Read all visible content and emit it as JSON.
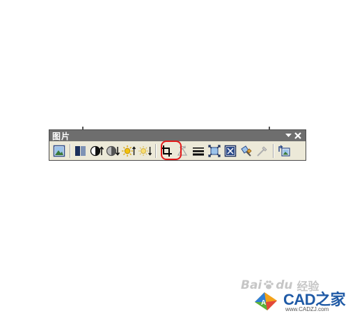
{
  "toolbar": {
    "title": "图片",
    "dropdown_icon": "triangle-down-icon",
    "close_icon": "close-icon",
    "buttons": [
      {
        "name": "insert-picture-button",
        "icon": "insert-picture-icon"
      },
      {
        "name": "image-control-button",
        "icon": "image-control-icon"
      },
      {
        "name": "more-contrast-button",
        "icon": "more-contrast-icon"
      },
      {
        "name": "less-contrast-button",
        "icon": "less-contrast-icon"
      },
      {
        "name": "more-brightness-button",
        "icon": "more-brightness-icon"
      },
      {
        "name": "less-brightness-button",
        "icon": "less-brightness-icon"
      },
      {
        "name": "crop-button",
        "icon": "crop-icon",
        "highlighted": true
      },
      {
        "name": "rotate-button",
        "icon": "rotate-icon",
        "disabled": true
      },
      {
        "name": "line-style-button",
        "icon": "line-style-icon"
      },
      {
        "name": "compress-pictures-button",
        "icon": "compress-pictures-icon"
      },
      {
        "name": "text-wrapping-button",
        "icon": "text-wrapping-icon"
      },
      {
        "name": "format-picture-button",
        "icon": "format-picture-icon"
      },
      {
        "name": "set-transparent-color-button",
        "icon": "set-transparent-color-icon",
        "disabled": true
      },
      {
        "name": "reset-picture-button",
        "icon": "reset-picture-icon"
      }
    ],
    "highlight_color": "#e21b1b"
  },
  "watermark": {
    "baidu_text": "Bai",
    "baidu_du": "du",
    "jingyan": "经验",
    "cad_brand": "CAD之家",
    "cad_url": "www.CADZJ.com"
  }
}
